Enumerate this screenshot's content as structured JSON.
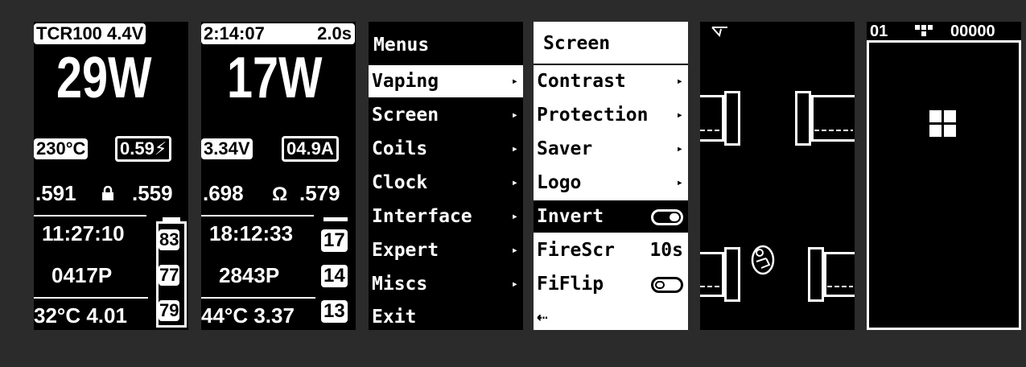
{
  "screen1": {
    "tcr": "TCR100 4.4V",
    "power": "29W",
    "temp": "230°C",
    "resistance": "0.59⚡",
    "res_left": ".591",
    "res_right": ".559",
    "time": "11:27:10",
    "puffs": "0417P",
    "bottom": "32°C 4.01",
    "batt": [
      "83",
      "77",
      "79"
    ]
  },
  "screen2": {
    "time": "2:14:07",
    "puff_time": "2.0s",
    "power": "17W",
    "voltage": "3.34V",
    "current": "04.9A",
    "res_left": ".698",
    "ohm": "Ω",
    "res_right": ".579",
    "clock": "18:12:33",
    "puffs": "2843P",
    "bottom": "44°C 3.37",
    "batt": [
      "17",
      "14",
      "13"
    ]
  },
  "menus": {
    "title": "Menus",
    "items": [
      "Vaping",
      "Screen",
      "Coils",
      "Clock",
      "Interface",
      "Expert",
      "Miscs",
      "Exit"
    ],
    "arrow": "▸"
  },
  "screen_menu": {
    "title": "Screen",
    "items": [
      "Contrast",
      "Protection",
      "Saver",
      "Logo",
      "Invert",
      "FireScr",
      "FiFlip"
    ],
    "firescr_value": "10s",
    "back": "⇠",
    "invert_on": true,
    "fiflip_on": false
  },
  "game": {
    "sound_icon": "speaker-icon"
  },
  "tetris": {
    "level": "01",
    "next_piece": "▀▄",
    "score": "00000"
  }
}
